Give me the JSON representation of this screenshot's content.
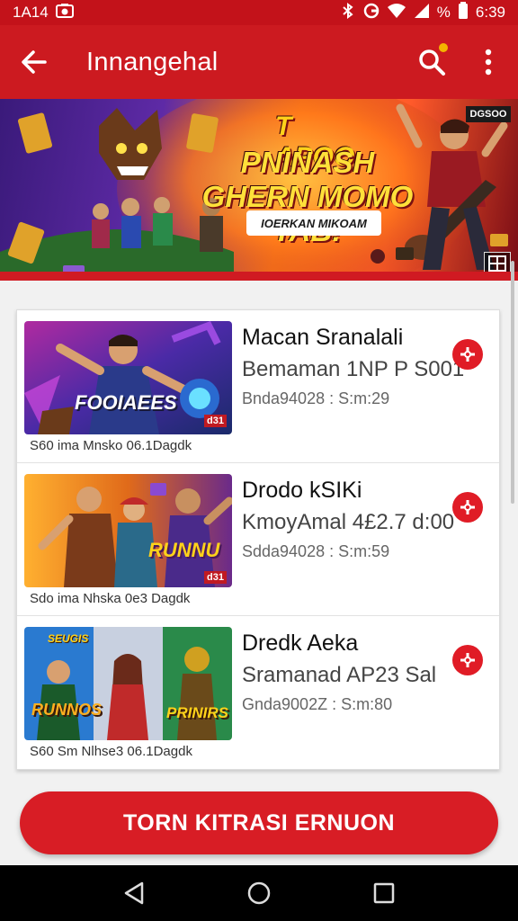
{
  "status_bar": {
    "time_left": "1A14",
    "time_right": "6:39",
    "battery_text": "%"
  },
  "app_bar": {
    "title": "Innangehal"
  },
  "banner": {
    "title_line1": "T APOO",
    "title_line2": "PNINASH GHERN MOMO TAB!",
    "chip": "IOERKAN MIKOAM",
    "badge": "DGSOO"
  },
  "items": [
    {
      "title": "Macan Sranalali",
      "subtitle": "Bemaman  1NP P S001",
      "meta": "Bnda94028 : S:m:29",
      "caption": "S60 ima Mnsko 06.1Dagdk",
      "thumb_text": "FOOIAEES",
      "thumb_badge": "d31"
    },
    {
      "title": "Drodo kSIKi",
      "subtitle": "KmoyAmal 4£2.7 d:00",
      "meta": "Sdda94028 : S:m:59",
      "caption": "Sdo ima Nhska 0e3 Dagdk",
      "thumb_text": "RUNNU",
      "thumb_badge": "d31"
    },
    {
      "title": "Dredk Aeka",
      "subtitle": "Sramanad AP23 Sal",
      "meta": "Gnda9002Z : S:m:80",
      "caption": "S60 Sm Nlhse3 06.1Dagdk",
      "thumb_text": "RUNNOS",
      "thumb_text2": "PRINIRS",
      "thumb_text3": "SEUGIS"
    }
  ],
  "cta": {
    "label": "TORN KITRASI ERNUON"
  },
  "colors": {
    "primary": "#cc1a20",
    "accent_dot": "#f4b400",
    "cta": "#d81d25"
  }
}
